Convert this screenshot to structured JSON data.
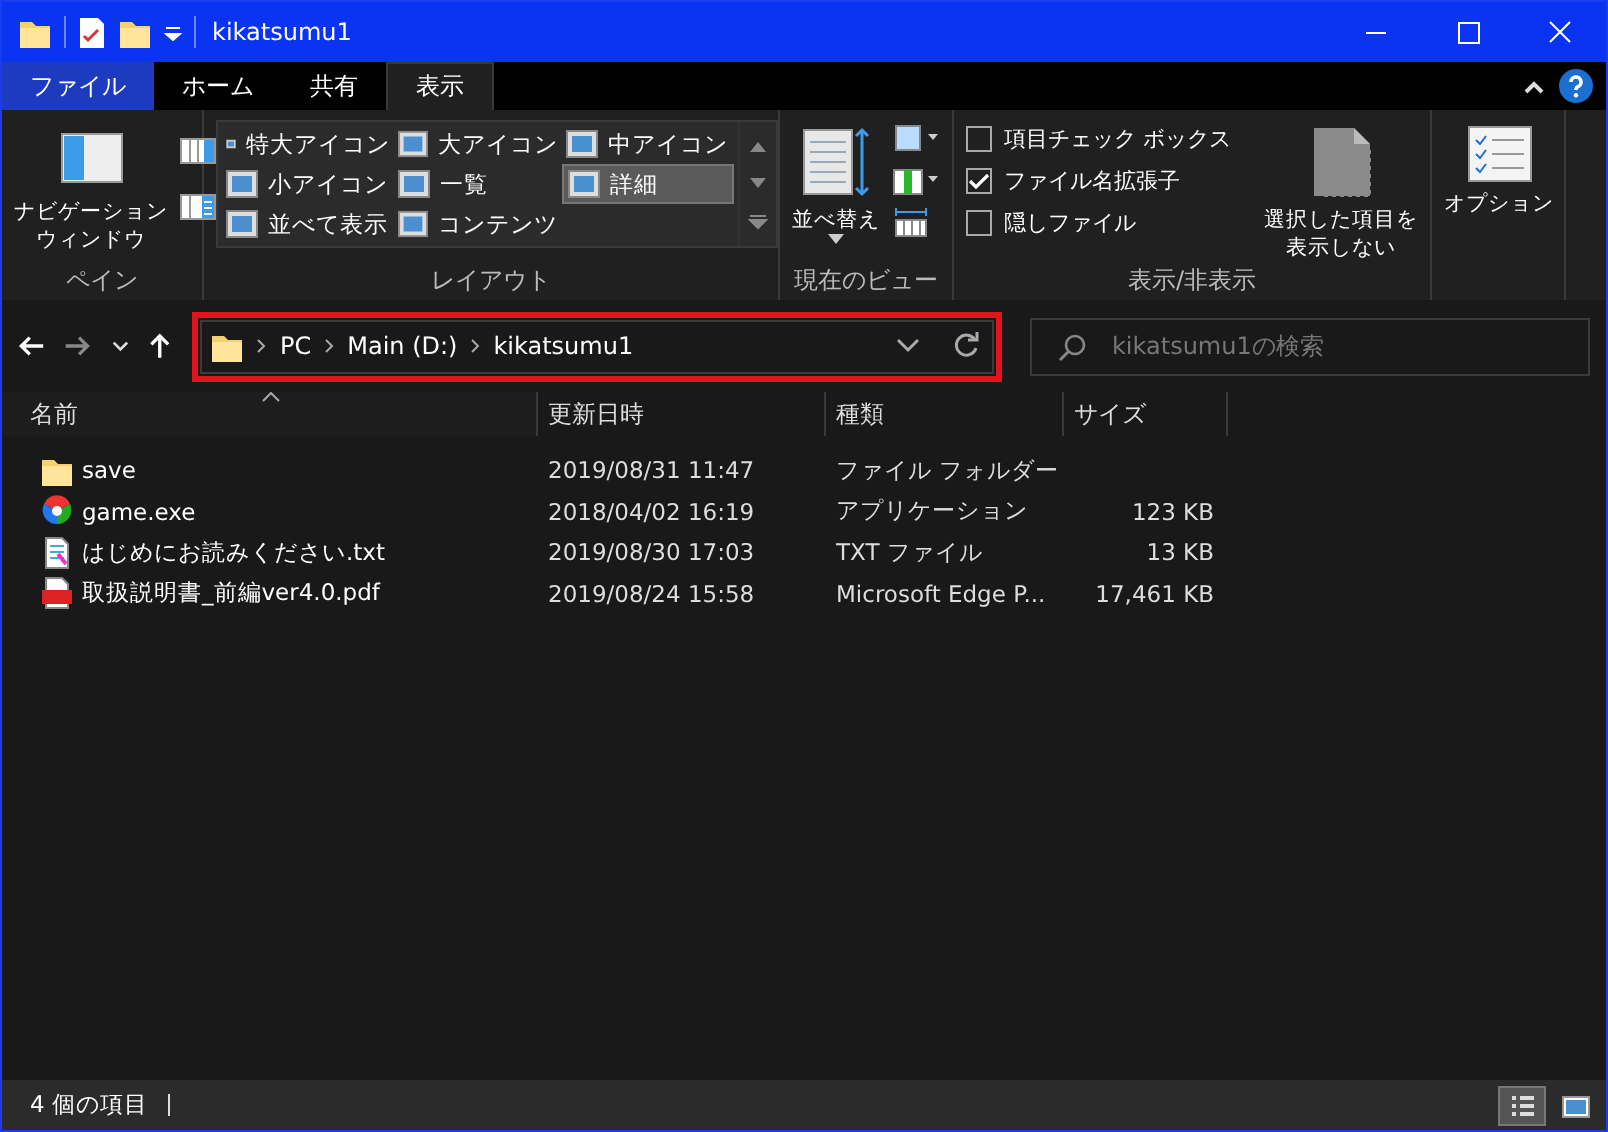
{
  "window": {
    "title": "kikatsumu1"
  },
  "ribbon": {
    "tabs": [
      {
        "label": "ファイル",
        "kind": "file",
        "selected": false
      },
      {
        "label": "ホーム",
        "kind": "tab",
        "selected": false
      },
      {
        "label": "共有",
        "kind": "tab",
        "selected": false
      },
      {
        "label": "表示",
        "kind": "tab",
        "selected": true
      }
    ],
    "groups": [
      {
        "kind": "pane",
        "label": "ペイン",
        "button_lines": [
          "ナビゲーション",
          "ウィンドウ"
        ]
      },
      {
        "kind": "layout",
        "label": "レイアウト",
        "options": [
          {
            "label": "特大アイコン",
            "selected": false
          },
          {
            "label": "大アイコン",
            "selected": false
          },
          {
            "label": "中アイコン",
            "selected": false
          },
          {
            "label": "小アイコン",
            "selected": false
          },
          {
            "label": "一覧",
            "selected": false
          },
          {
            "label": "詳細",
            "selected": true
          },
          {
            "label": "並べて表示",
            "selected": false
          },
          {
            "label": "コンテンツ",
            "selected": false
          }
        ]
      },
      {
        "kind": "view",
        "label": "現在のビュー",
        "button": "並べ替え"
      },
      {
        "kind": "showhide",
        "label": "表示/非表示",
        "checks": [
          {
            "label": "項目チェック ボックス",
            "checked": false
          },
          {
            "label": "ファイル名拡張子",
            "checked": true
          },
          {
            "label": "隠しファイル",
            "checked": false
          }
        ],
        "button_lines": [
          "選択した項目を",
          "表示しない"
        ]
      },
      {
        "kind": "options",
        "button": "オプション"
      }
    ]
  },
  "address": {
    "path": [
      "PC",
      "Main (D:)",
      "kikatsumu1"
    ],
    "highlighted": true
  },
  "search": {
    "placeholder": "kikatsumu1の検索"
  },
  "columns": [
    {
      "label": "名前",
      "sorted": true
    },
    {
      "label": "更新日時",
      "sorted": false
    },
    {
      "label": "種類",
      "sorted": false
    },
    {
      "label": "サイズ",
      "sorted": false
    }
  ],
  "rows": [
    {
      "kind": "folder",
      "name": "save",
      "date": "2019/08/31 11:47",
      "type": "ファイル フォルダー",
      "size": ""
    },
    {
      "kind": "exe",
      "name": "game.exe",
      "date": "2018/04/02 16:19",
      "type": "アプリケーション",
      "size": "123 KB"
    },
    {
      "kind": "txt",
      "name": "はじめにお読みください.txt",
      "date": "2019/08/30 17:03",
      "type": "TXT ファイル",
      "size": "13 KB"
    },
    {
      "kind": "pdf",
      "name": "取扱説明書_前編ver4.0.pdf",
      "date": "2019/08/24 15:58",
      "type": "Microsoft Edge P...",
      "size": "17,461 KB"
    }
  ],
  "status_bar": {
    "count": "4 個の項目",
    "views": [
      {
        "kind": "details",
        "selected": true
      },
      {
        "kind": "large",
        "selected": false
      }
    ]
  }
}
